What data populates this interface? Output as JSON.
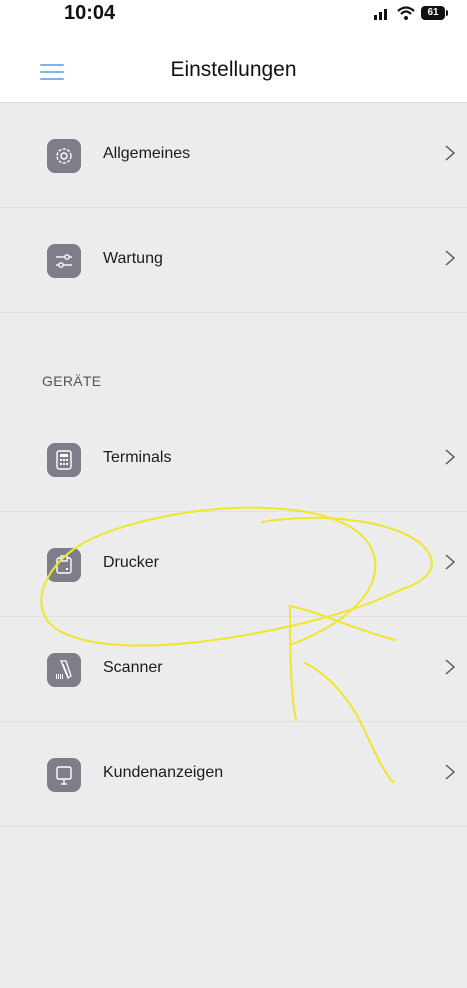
{
  "status_bar": {
    "time": "10:04",
    "battery": "61",
    "icons": [
      "signal-icon",
      "wifi-icon",
      "battery-icon"
    ]
  },
  "nav": {
    "title": "Einstellungen",
    "menu_icon": "hamburger-menu-icon"
  },
  "colors": {
    "accent": "#7fb2e8",
    "icon_bg": "#7e7e8a",
    "annotation": "#f0e62b"
  },
  "settings": {
    "items": [
      {
        "label": "Allgemeines",
        "icon": "gear-icon"
      },
      {
        "label": "Wartung",
        "icon": "sliders-icon"
      }
    ]
  },
  "devices": {
    "header": "GERÄTE",
    "items": [
      {
        "label": "Terminals",
        "icon": "calculator-icon"
      },
      {
        "label": "Drucker",
        "icon": "printer-icon"
      },
      {
        "label": "Scanner",
        "icon": "barcode-scanner-icon"
      },
      {
        "label": "Kundenanzeigen",
        "icon": "customer-display-icon"
      }
    ]
  }
}
